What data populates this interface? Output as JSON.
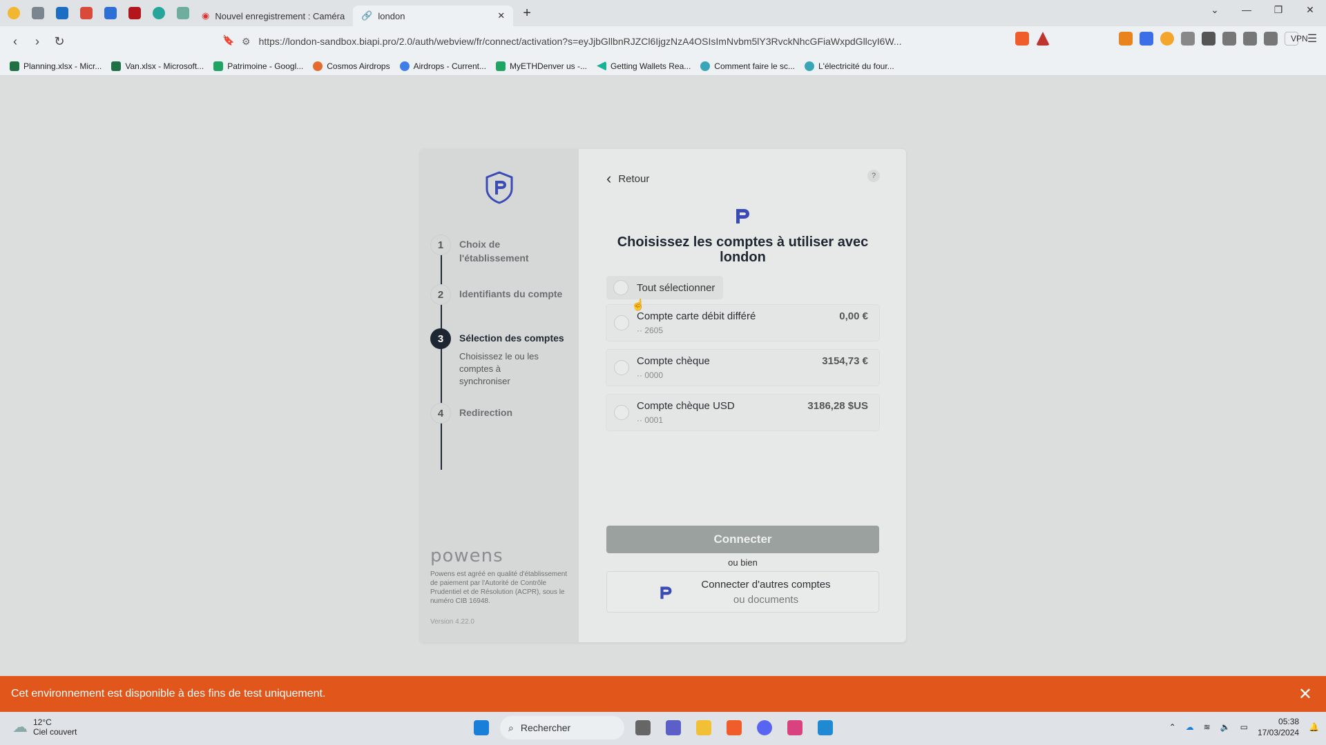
{
  "browser": {
    "tabs": [
      {
        "label": "Nouvel enregistrement : Caméra",
        "active": false
      },
      {
        "label": "london",
        "active": true
      }
    ],
    "new_tab": "+",
    "url": "https://london-sandbox.biapi.pro/2.0/auth/webview/fr/connect/activation?s=eyJjbGllbnRJZCl6IjgzNzA4OSIsImNvbm5lY3RvckNhcGFiaWxpdGllcyI6W...",
    "vpn": "VPN",
    "bookmarks": [
      "Planning.xlsx - Micr...",
      "Van.xlsx - Microsoft...",
      "Patrimoine - Googl...",
      "Cosmos Airdrops",
      "Airdrops - Current...",
      "MyETHDenver us -...",
      "Getting Wallets Rea...",
      "Comment faire le sc...",
      "L'électricité du four..."
    ]
  },
  "sidebar": {
    "steps": [
      {
        "num": "1",
        "label": "Choix de l'établissement"
      },
      {
        "num": "2",
        "label": "Identifiants du compte"
      },
      {
        "num": "3",
        "label": "Sélection des comptes",
        "sub": "Choisissez le ou les comptes à synchroniser"
      },
      {
        "num": "4",
        "label": "Redirection"
      }
    ],
    "brand": "powens",
    "legal": "Powens est agréé en qualité d'établissement de paiement par l'Autorité de Contrôle Prudentiel et de Résolution (ACPR), sous le numéro CIB 16948.",
    "version": "Version 4.22.0"
  },
  "main": {
    "back_label": "Retour",
    "help": "?",
    "title": "Choisissez les comptes à utiliser avec london",
    "select_all": "Tout sélectionner",
    "accounts": [
      {
        "name": "Compte carte débit différé",
        "number": "·· 2605",
        "balance": "0,00 €"
      },
      {
        "name": "Compte chèque",
        "number": "·· 0000",
        "balance": "3154,73 €"
      },
      {
        "name": "Compte chèque USD",
        "number": "·· 0001",
        "balance": "3186,28 $US"
      }
    ],
    "connect": "Connecter",
    "or": "ou bien",
    "other_title": "Connecter d'autres comptes",
    "other_sub": "ou documents"
  },
  "banner": {
    "text": "Cet environnement est disponible à des fins de test uniquement.",
    "close": "✕"
  },
  "taskbar": {
    "temp": "12°C",
    "weather": "Ciel couvert",
    "search": "Rechercher",
    "time": "05:38",
    "date": "17/03/2024"
  },
  "colors": {
    "accent": "#1e2631",
    "banner": "#e0561b",
    "logo": "#3b4bb5"
  }
}
